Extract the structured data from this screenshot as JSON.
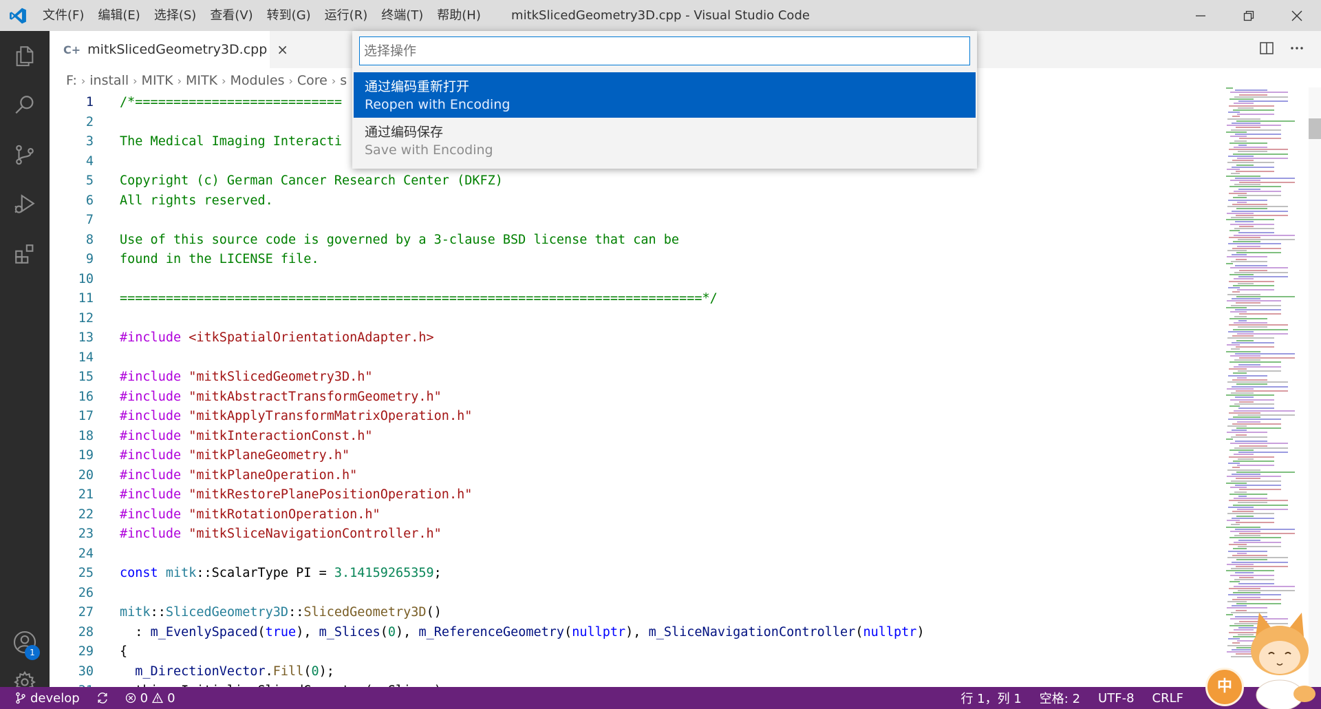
{
  "window": {
    "title": "mitkSlicedGeometry3D.cpp - Visual Studio Code",
    "menu": [
      "文件(F)",
      "编辑(E)",
      "选择(S)",
      "查看(V)",
      "转到(G)",
      "运行(R)",
      "终端(T)",
      "帮助(H)"
    ]
  },
  "activity_bar": {
    "icons": [
      "files-icon",
      "search-icon",
      "source-control-icon",
      "run-debug-icon",
      "extensions-icon"
    ],
    "accounts_badge": "1"
  },
  "tab": {
    "icon_glyph": "C+",
    "label": "mitkSlicedGeometry3D.cpp",
    "close": "×"
  },
  "breadcrumb": [
    "F:",
    "install",
    "MITK",
    "MITK",
    "Modules",
    "Core",
    "s"
  ],
  "quick_pick": {
    "placeholder": "选择操作",
    "items": [
      {
        "label": "通过编码重新打开",
        "description": "Reopen with Encoding",
        "selected": true
      },
      {
        "label": "通过编码保存",
        "description": "Save with Encoding",
        "selected": false
      }
    ]
  },
  "code_lines": [
    {
      "n": "1",
      "tokens": [
        {
          "t": "/*===========================",
          "c": "com"
        }
      ]
    },
    {
      "n": "2",
      "tokens": []
    },
    {
      "n": "3",
      "tokens": [
        {
          "t": "The Medical Imaging Interacti",
          "c": "com"
        }
      ]
    },
    {
      "n": "4",
      "tokens": []
    },
    {
      "n": "5",
      "tokens": [
        {
          "t": "Copyright (c) German Cancer Research Center (DKFZ)",
          "c": "com"
        }
      ]
    },
    {
      "n": "6",
      "tokens": [
        {
          "t": "All rights reserved.",
          "c": "com"
        }
      ]
    },
    {
      "n": "7",
      "tokens": []
    },
    {
      "n": "8",
      "tokens": [
        {
          "t": "Use of this source code is governed by a 3-clause BSD license that can be",
          "c": "com"
        }
      ]
    },
    {
      "n": "9",
      "tokens": [
        {
          "t": "found in the LICENSE file.",
          "c": "com"
        }
      ]
    },
    {
      "n": "10",
      "tokens": []
    },
    {
      "n": "11",
      "tokens": [
        {
          "t": "============================================================================*/",
          "c": "com"
        }
      ]
    },
    {
      "n": "12",
      "tokens": []
    },
    {
      "n": "13",
      "tokens": [
        {
          "t": "#include ",
          "c": "inc"
        },
        {
          "t": "<itkSpatialOrientationAdapter.h>",
          "c": "str"
        }
      ]
    },
    {
      "n": "14",
      "tokens": []
    },
    {
      "n": "15",
      "tokens": [
        {
          "t": "#include ",
          "c": "inc"
        },
        {
          "t": "\"mitkSlicedGeometry3D.h\"",
          "c": "str"
        }
      ]
    },
    {
      "n": "16",
      "tokens": [
        {
          "t": "#include ",
          "c": "inc"
        },
        {
          "t": "\"mitkAbstractTransformGeometry.h\"",
          "c": "str"
        }
      ]
    },
    {
      "n": "17",
      "tokens": [
        {
          "t": "#include ",
          "c": "inc"
        },
        {
          "t": "\"mitkApplyTransformMatrixOperation.h\"",
          "c": "str"
        }
      ]
    },
    {
      "n": "18",
      "tokens": [
        {
          "t": "#include ",
          "c": "inc"
        },
        {
          "t": "\"mitkInteractionConst.h\"",
          "c": "str"
        }
      ]
    },
    {
      "n": "19",
      "tokens": [
        {
          "t": "#include ",
          "c": "inc"
        },
        {
          "t": "\"mitkPlaneGeometry.h\"",
          "c": "str"
        }
      ]
    },
    {
      "n": "20",
      "tokens": [
        {
          "t": "#include ",
          "c": "inc"
        },
        {
          "t": "\"mitkPlaneOperation.h\"",
          "c": "str"
        }
      ]
    },
    {
      "n": "21",
      "tokens": [
        {
          "t": "#include ",
          "c": "inc"
        },
        {
          "t": "\"mitkRestorePlanePositionOperation.h\"",
          "c": "str"
        }
      ]
    },
    {
      "n": "22",
      "tokens": [
        {
          "t": "#include ",
          "c": "inc"
        },
        {
          "t": "\"mitkRotationOperation.h\"",
          "c": "str"
        }
      ]
    },
    {
      "n": "23",
      "tokens": [
        {
          "t": "#include ",
          "c": "inc"
        },
        {
          "t": "\"mitkSliceNavigationController.h\"",
          "c": "str"
        }
      ]
    },
    {
      "n": "24",
      "tokens": []
    },
    {
      "n": "25",
      "tokens": [
        {
          "t": "const ",
          "c": "kw"
        },
        {
          "t": "mitk",
          "c": "type"
        },
        {
          "t": "::ScalarType PI = ",
          "c": "plain"
        },
        {
          "t": "3.14159265359",
          "c": "num"
        },
        {
          "t": ";",
          "c": "plain"
        }
      ]
    },
    {
      "n": "26",
      "tokens": []
    },
    {
      "n": "27",
      "tokens": [
        {
          "t": "mitk",
          "c": "type"
        },
        {
          "t": "::",
          "c": "plain"
        },
        {
          "t": "SlicedGeometry3D",
          "c": "type"
        },
        {
          "t": "::",
          "c": "plain"
        },
        {
          "t": "SlicedGeometry3D",
          "c": "fn"
        },
        {
          "t": "()",
          "c": "plain"
        }
      ]
    },
    {
      "n": "28",
      "tokens": [
        {
          "t": "  : ",
          "c": "plain"
        },
        {
          "t": "m_EvenlySpaced",
          "c": "var"
        },
        {
          "t": "(",
          "c": "plain"
        },
        {
          "t": "true",
          "c": "kw"
        },
        {
          "t": "), ",
          "c": "plain"
        },
        {
          "t": "m_Slices",
          "c": "var"
        },
        {
          "t": "(",
          "c": "plain"
        },
        {
          "t": "0",
          "c": "num"
        },
        {
          "t": "), ",
          "c": "plain"
        },
        {
          "t": "m_ReferenceGeometry",
          "c": "var"
        },
        {
          "t": "(",
          "c": "plain"
        },
        {
          "t": "nullptr",
          "c": "kw"
        },
        {
          "t": "), ",
          "c": "plain"
        },
        {
          "t": "m_SliceNavigationController",
          "c": "var"
        },
        {
          "t": "(",
          "c": "plain"
        },
        {
          "t": "nullptr",
          "c": "kw"
        },
        {
          "t": ")",
          "c": "plain"
        }
      ]
    },
    {
      "n": "29",
      "tokens": [
        {
          "t": "{",
          "c": "plain"
        }
      ]
    },
    {
      "n": "30",
      "tokens": [
        {
          "t": "  ",
          "c": "plain"
        },
        {
          "t": "m_DirectionVector",
          "c": "var"
        },
        {
          "t": ".",
          "c": "plain"
        },
        {
          "t": "Fill",
          "c": "fn"
        },
        {
          "t": "(",
          "c": "plain"
        },
        {
          "t": "0",
          "c": "num"
        },
        {
          "t": ");",
          "c": "plain"
        }
      ]
    },
    {
      "n": "31",
      "tokens": [
        {
          "t": "  this->InitializeSlicedGeometry(m_Slices);",
          "c": "plain"
        }
      ]
    }
  ],
  "status_bar": {
    "branch": "develop",
    "errors": "0",
    "warnings": "0",
    "position": "行 1，列 1",
    "indent": "空格: 2",
    "encoding": "UTF-8",
    "eol": "CRLF"
  },
  "ime": {
    "label": "中"
  },
  "colors": {
    "accent": "#0078d4",
    "selection": "#0060c0",
    "statusbar": "#68217a",
    "activitybar": "#2c2c2c",
    "titlebar": "#dddddd"
  }
}
